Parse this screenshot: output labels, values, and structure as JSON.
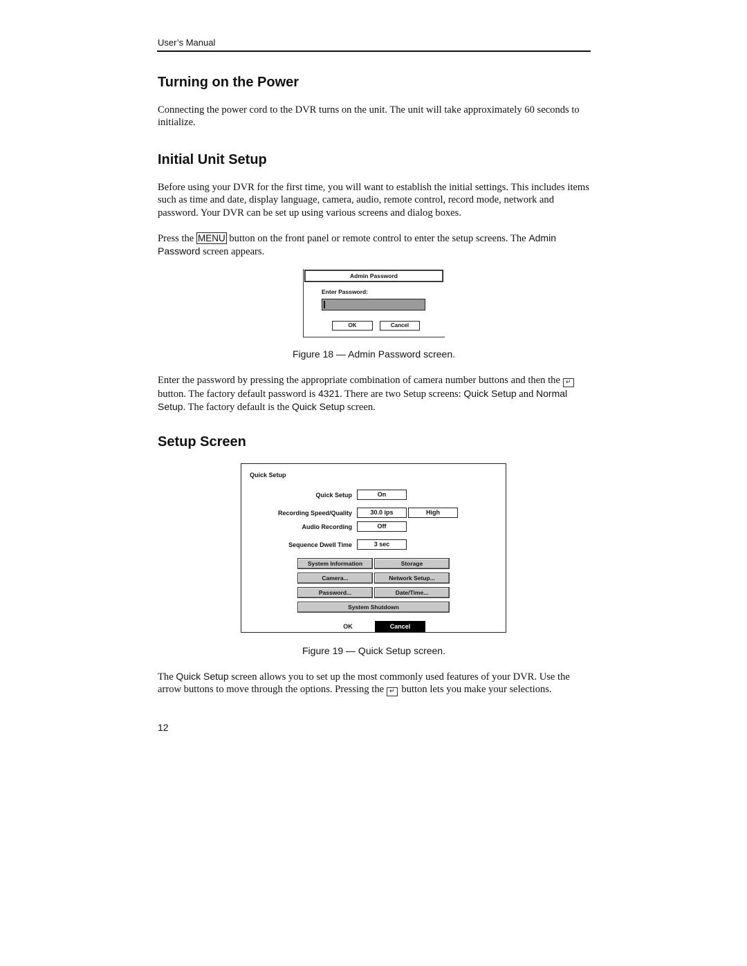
{
  "header": {
    "running_title": "User’s Manual"
  },
  "sections": {
    "power": {
      "heading": "Turning on the Power",
      "paragraph": "Connecting the power cord to the DVR turns on the unit.  The unit will take approximately 60 seconds to initialize."
    },
    "initial": {
      "heading": "Initial Unit Setup",
      "paragraph1": "Before using your DVR for the first time, you will want to establish the initial settings.  This includes items such as time and date, display language, camera, audio, remote control, record mode, network and password.  Your DVR can be set up using various screens and dialog boxes.",
      "p2_before": "Press the ",
      "p2_key": "MENU",
      "p2_middle": " button on the front panel or remote control to enter the setup screens.  The ",
      "p2_ui": "Admin Password",
      "p2_after": " screen appears."
    },
    "after_fig18": {
      "p_part1": "Enter the password by pressing the appropriate combination of camera number buttons and then the ",
      "enter_icon": "enter-key-icon",
      "p_part2": " button.  The factory default password is ",
      "password": "4321",
      "p_part3": ".  There are two Setup screens: ",
      "ui1": "Quick Setup",
      "p_part4": " and ",
      "ui2": "Normal Setup",
      "p_part5": ".  The factory default is the ",
      "ui3": "Quick Setup",
      "p_part6": " screen."
    },
    "setup_screen": {
      "heading": "Setup Screen",
      "p_before": "The ",
      "p_ui": "Quick Setup",
      "p_middle": " screen allows you to set up the most commonly used features of your DVR.  Use the arrow buttons to move through the options.  Pressing the ",
      "p_after": " button lets you make your selections."
    }
  },
  "figure18": {
    "caption": "Figure 18 — Admin Password screen.",
    "title": "Admin Password",
    "label": "Enter Password:",
    "password_value": "",
    "ok": "OK",
    "cancel": "Cancel"
  },
  "figure19": {
    "caption": "Figure 19 — Quick Setup screen.",
    "title": "Quick Setup",
    "rows": [
      {
        "label": "Quick Setup",
        "values": [
          "On"
        ]
      },
      {
        "label": "Recording Speed/Quality",
        "values": [
          "30.0 ips",
          "High"
        ]
      },
      {
        "label": "Audio Recording",
        "values": [
          "Off"
        ]
      },
      {
        "label": "Sequence Dwell Time",
        "values": [
          "3 sec"
        ]
      }
    ],
    "buttons": [
      "System Information",
      "Storage",
      "Camera...",
      "Network Setup...",
      "Password...",
      "Date/Time...",
      "System Shutdown"
    ],
    "ok": "OK",
    "cancel": "Cancel"
  },
  "footer": {
    "page_number": "12"
  }
}
